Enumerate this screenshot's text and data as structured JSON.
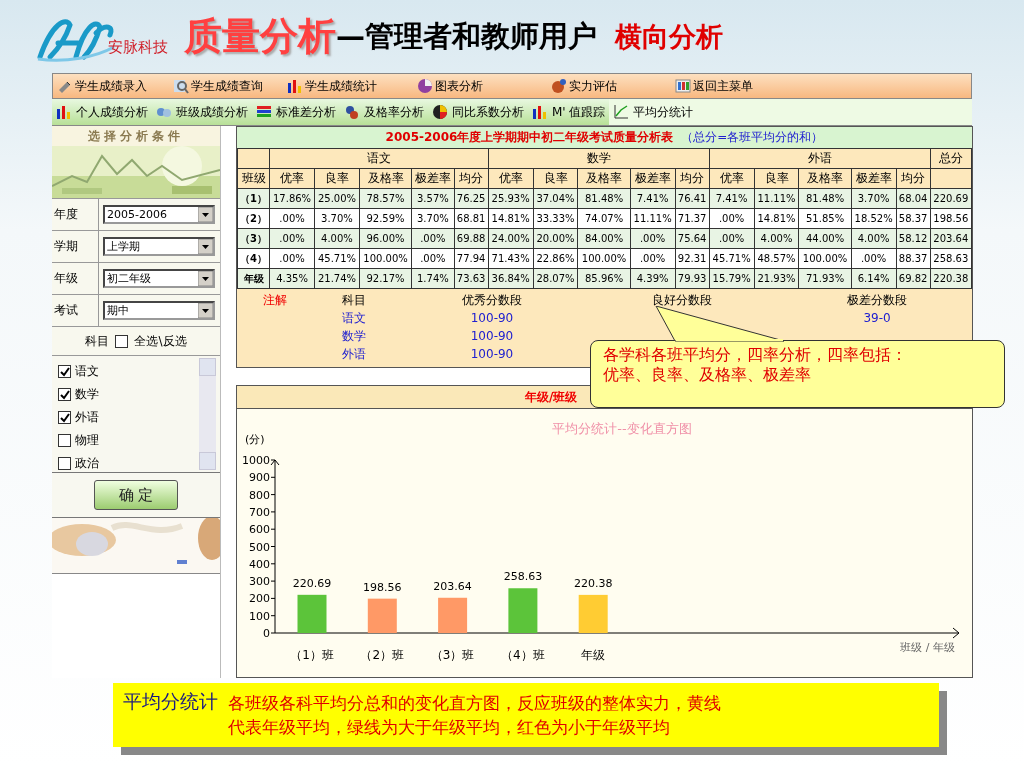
{
  "header": {
    "logo_text": "安脉科技",
    "title": "质量分析",
    "subtitle": "—管理者和教师用户",
    "tag": "横向分析"
  },
  "menu_main": [
    {
      "label": "学生成绩录入"
    },
    {
      "label": "学生成绩查询"
    },
    {
      "label": "学生成绩统计"
    },
    {
      "label": "图表分析"
    },
    {
      "label": "实力评估"
    },
    {
      "label": "返回主菜单"
    }
  ],
  "menu_sub": [
    {
      "label": "个人成绩分析",
      "selected": false
    },
    {
      "label": "班级成绩分析",
      "selected": false
    },
    {
      "label": "标准差分析",
      "selected": false
    },
    {
      "label": "及格率分析",
      "selected": false
    },
    {
      "label": "同比系数分析",
      "selected": false
    },
    {
      "label": "M' 值跟踪",
      "selected": false
    },
    {
      "label": "平均分统计",
      "selected": true
    }
  ],
  "filter": {
    "title": "选择分析条件",
    "fields": [
      {
        "label": "年度",
        "value": "2005-2006"
      },
      {
        "label": "学期",
        "value": "上学期"
      },
      {
        "label": "年级",
        "value": "初二年级"
      },
      {
        "label": "考试",
        "value": "期中"
      }
    ],
    "subject_label": "科目",
    "select_all": {
      "label": "全选\\反选",
      "checked": false
    },
    "subjects": [
      {
        "label": "语文",
        "checked": true
      },
      {
        "label": "数学",
        "checked": true
      },
      {
        "label": "外语",
        "checked": true
      },
      {
        "label": "物理",
        "checked": false
      },
      {
        "label": "政治",
        "checked": false
      }
    ],
    "confirm": "确 定"
  },
  "table": {
    "title": "2005-2006年度上学期期中初二年级考试质量分析表",
    "note": "（总分=各班平均分的和）",
    "groups": [
      "语文",
      "数学",
      "外语"
    ],
    "total": "总分",
    "row_header": "班级",
    "columns": [
      "优率",
      "良率",
      "及格率",
      "极差率",
      "均分",
      "优率",
      "良率",
      "及格率",
      "极差率",
      "均分",
      "优率",
      "良率",
      "及格率",
      "极差率",
      "均分"
    ],
    "rows": [
      {
        "label": "（1）",
        "cells": [
          "17.86%",
          "25.00%",
          "78.57%",
          "3.57%",
          "76.25",
          "25.93%",
          "37.04%",
          "81.48%",
          "7.41%",
          "76.41",
          "7.41%",
          "11.11%",
          "81.48%",
          "3.70%",
          "68.04",
          "220.69"
        ]
      },
      {
        "label": "（2）",
        "cells": [
          ".00%",
          "3.70%",
          "92.59%",
          "3.70%",
          "68.81",
          "14.81%",
          "33.33%",
          "74.07%",
          "11.11%",
          "71.37",
          ".00%",
          "14.81%",
          "51.85%",
          "18.52%",
          "58.37",
          "198.56"
        ]
      },
      {
        "label": "（3）",
        "cells": [
          ".00%",
          "4.00%",
          "96.00%",
          ".00%",
          "69.88",
          "24.00%",
          "20.00%",
          "84.00%",
          ".00%",
          "75.64",
          ".00%",
          "4.00%",
          "44.00%",
          "4.00%",
          "58.12",
          "203.64"
        ]
      },
      {
        "label": "（4）",
        "cells": [
          ".00%",
          "45.71%",
          "100.00%",
          ".00%",
          "77.94",
          "71.43%",
          "22.86%",
          "100.00%",
          ".00%",
          "92.31",
          "45.71%",
          "48.57%",
          "100.00%",
          ".00%",
          "88.37",
          "258.63"
        ]
      },
      {
        "label": "年级",
        "cells": [
          "4.35%",
          "21.74%",
          "92.17%",
          "1.74%",
          "73.63",
          "36.84%",
          "28.07%",
          "85.96%",
          "4.39%",
          "79.93",
          "15.79%",
          "21.93%",
          "71.93%",
          "6.14%",
          "69.82",
          "220.38"
        ]
      }
    ]
  },
  "legend": {
    "title": "注解",
    "headers": [
      "科目",
      "优秀分数段",
      "良好分数段",
      "极差分数段"
    ],
    "rows": [
      {
        "subject": "语文",
        "excellent": "100-90",
        "poor": "39-0"
      },
      {
        "subject": "数学",
        "excellent": "100-90"
      },
      {
        "subject": "外语",
        "excellent": "100-90"
      }
    ]
  },
  "chart_panel": {
    "header": "年级/班级",
    "chart_data": {
      "type": "bar",
      "title": "平均分统计--变化直方图",
      "ylabel": "(分)",
      "annotations": [
        {
          "text": "班级 / 年级"
        }
      ],
      "categories": [
        "（1）班",
        "（2）班",
        "（3）班",
        "（4）班",
        "年级"
      ],
      "series": [
        {
          "color": "#5cc43a",
          "values": [
            220.69,
            null,
            null,
            258.63,
            null
          ]
        },
        {
          "color": "#ff9966",
          "values": [
            null,
            198.56,
            203.64,
            null,
            null
          ]
        },
        {
          "color": "#ffcc33",
          "values": [
            null,
            null,
            null,
            null,
            220.38
          ]
        }
      ],
      "ylim": [
        0,
        1000
      ],
      "yticks": [
        0,
        100,
        200,
        300,
        400,
        500,
        600,
        700,
        800,
        900,
        1000
      ],
      "data_labels": true
    }
  },
  "callout": "各学科各班平均分，四率分析，四率包括：优率、良率、及格率、极差率",
  "footer": {
    "title": "平均分统计",
    "text": "各班级各科平均分总和的变化直方图，反应班级的整体实力，黄线代表年级平均，绿线为大于年级平均，红色为小于年级平均"
  }
}
